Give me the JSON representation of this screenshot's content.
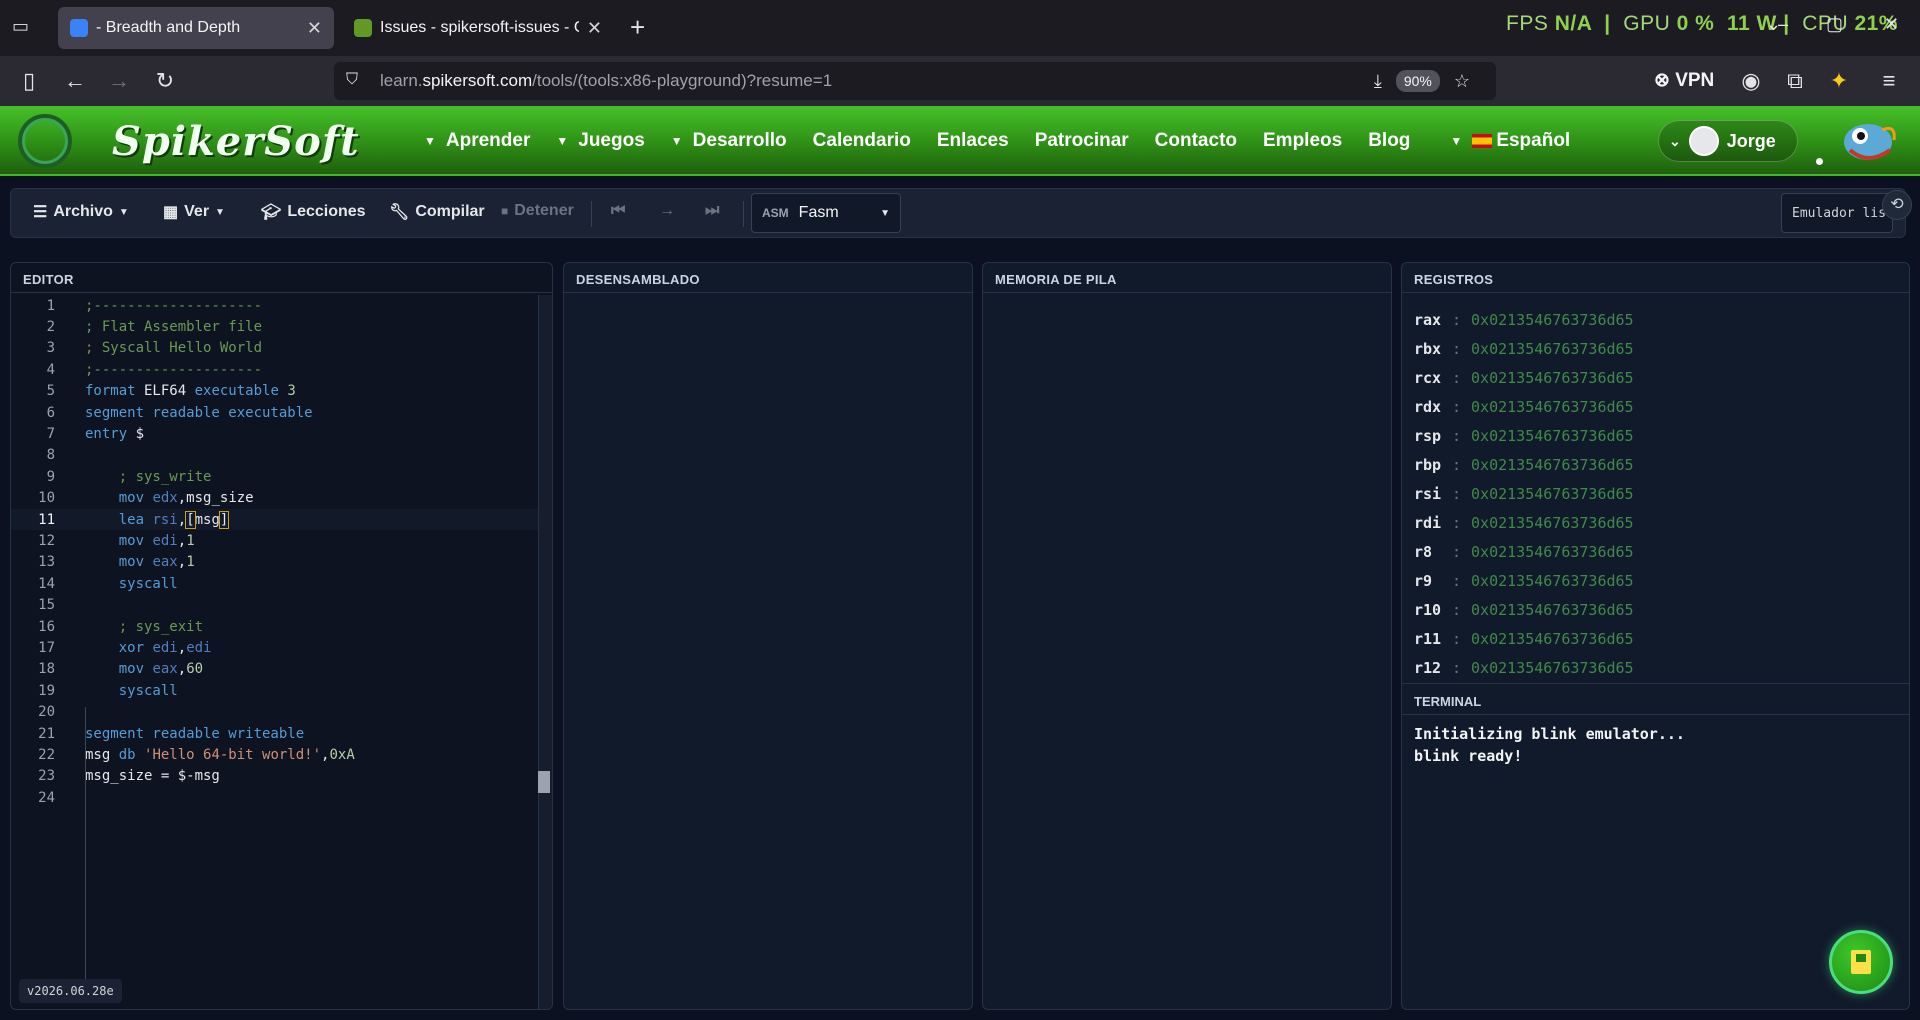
{
  "browser": {
    "tabs": [
      {
        "label": "- Breadth and Depth",
        "active": true
      },
      {
        "label": "Issues - spikersoft-issues - Gitea",
        "active": false
      }
    ],
    "perf": {
      "fps_label": "FPS",
      "fps_value": "N/A",
      "gpu_label": "GPU",
      "gpu_value": "0 %",
      "watts": "11 W",
      "cpu_label": "CPU",
      "cpu_value": "21%"
    },
    "url_prefix": "learn.",
    "url_domain": "spikersoft.com",
    "url_path": "/tools/(tools:x86-playground)?resume=1",
    "zoom": "90%",
    "vpn": "VPN"
  },
  "site": {
    "logo": "SpikerSoft",
    "menu": [
      {
        "label": "Aprender",
        "dropdown": true
      },
      {
        "label": "Juegos",
        "dropdown": true
      },
      {
        "label": "Desarrollo",
        "dropdown": true
      },
      {
        "label": "Calendario",
        "dropdown": false
      },
      {
        "label": "Enlaces",
        "dropdown": false
      },
      {
        "label": "Patrocinar",
        "dropdown": false
      },
      {
        "label": "Contacto",
        "dropdown": false
      },
      {
        "label": "Empleos",
        "dropdown": false
      },
      {
        "label": "Blog",
        "dropdown": false
      }
    ],
    "language": "Español",
    "user": "Jorge"
  },
  "toolbar": {
    "archivo": "Archivo",
    "ver": "Ver",
    "lecciones": "Lecciones",
    "compilar": "Compilar",
    "detener": "Detener",
    "asm_tag": "ASM",
    "assembler": "Fasm",
    "status": "Emulador listo"
  },
  "panels": {
    "editor": "EDITOR",
    "disasm": "DESENSAMBLADO",
    "stack": "MEMORIA DE PILA",
    "registers": "REGISTROS",
    "terminal": "TERMINAL"
  },
  "editor": {
    "current_line": 11,
    "version": "v2026.06.28e"
  },
  "registers": [
    {
      "name": "rax",
      "value": "0x0213546763736d65"
    },
    {
      "name": "rbx",
      "value": "0x0213546763736d65"
    },
    {
      "name": "rcx",
      "value": "0x0213546763736d65"
    },
    {
      "name": "rdx",
      "value": "0x0213546763736d65"
    },
    {
      "name": "rsp",
      "value": "0x0213546763736d65"
    },
    {
      "name": "rbp",
      "value": "0x0213546763736d65"
    },
    {
      "name": "rsi",
      "value": "0x0213546763736d65"
    },
    {
      "name": "rdi",
      "value": "0x0213546763736d65"
    },
    {
      "name": "r8",
      "value": "0x0213546763736d65"
    },
    {
      "name": "r9",
      "value": "0x0213546763736d65"
    },
    {
      "name": "r10",
      "value": "0x0213546763736d65"
    },
    {
      "name": "r11",
      "value": "0x0213546763736d65"
    },
    {
      "name": "r12",
      "value": "0x0213546763736d65"
    }
  ],
  "terminal": {
    "lines": [
      "Initializing blink emulator...",
      "blink ready!"
    ]
  },
  "icons": {
    "tab_list": "tab-list-icon",
    "back": "back-arrow-icon",
    "forward": "forward-arrow-icon",
    "reload": "reload-icon",
    "bookmark": "star-icon",
    "fab": "book-icon"
  }
}
